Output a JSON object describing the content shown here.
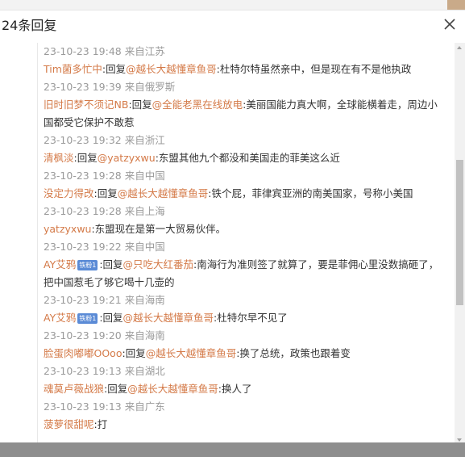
{
  "dialog": {
    "title": "24条回复"
  },
  "replies": [
    {
      "time": "23-10-23 19:48 来自江苏",
      "user": "Tim菌多忙中",
      "reply_prefix": ":回复",
      "reply_to": "@越长大越懂章鱼哥",
      "text": ":杜特尔特虽然亲中，但是现在有不是他执政"
    },
    {
      "time": "23-10-23 19:39 来自俄罗斯",
      "user": "旧时旧梦不须记NB",
      "reply_prefix": ":回复",
      "reply_to": "@全能老黑在线放电",
      "text": ":美丽国能力真大啊，全球能横着走，周边小国都受它保护不敢惹"
    },
    {
      "time": "23-10-23 19:32 来自浙江",
      "user": "清枫淡",
      "reply_prefix": ":回复",
      "reply_to": "@yatzyxwu",
      "text": ":东盟其他九个都没和美国走的菲美这么近"
    },
    {
      "time": "23-10-23 19:28 来自中国",
      "user": "没定力得改",
      "reply_prefix": ":回复",
      "reply_to": "@越长大越懂章鱼哥",
      "text": ":铁个屁，菲律宾亚洲的南美国家，号称小美国"
    },
    {
      "time": "23-10-23 19:28 来自上海",
      "user": "yatzyxwu",
      "reply_prefix": "",
      "reply_to": "",
      "text": ":东盟现在是第一大贸易伙伴。"
    },
    {
      "time": "23-10-23 19:22 来自中国",
      "user": "AY艾鸦",
      "badge": "铁粉1",
      "reply_prefix": ":回复",
      "reply_to": "@只吃大红番茄",
      "text": ":南海行为准则签了就算了，要是菲佣心里没数搞砸了，把中国惹毛了够它喝十几壶的"
    },
    {
      "time": "23-10-23 19:21 来自海南",
      "user": "AY艾鸦",
      "badge": "铁粉1",
      "reply_prefix": ":回复",
      "reply_to": "@越长大越懂章鱼哥",
      "text": ":杜特尔早不见了"
    },
    {
      "time": "23-10-23 19:20 来自海南",
      "user": "脸蛋肉嘟嘟OOoo",
      "reply_prefix": ":回复",
      "reply_to": "@越长大越懂章鱼哥",
      "text": ":换了总统，政策也跟着变"
    },
    {
      "time": "23-10-23 19:13 来自湖北",
      "user": "魂莫卢薇战狼",
      "reply_prefix": ":回复",
      "reply_to": "@越长大越懂章鱼哥",
      "text": ":换人了"
    },
    {
      "time": "23-10-23 19:13 来自广东",
      "user": "菠萝很甜呢",
      "reply_prefix": "",
      "reply_to": "",
      "text": ":打"
    }
  ],
  "icons": {
    "close": "close-icon"
  }
}
